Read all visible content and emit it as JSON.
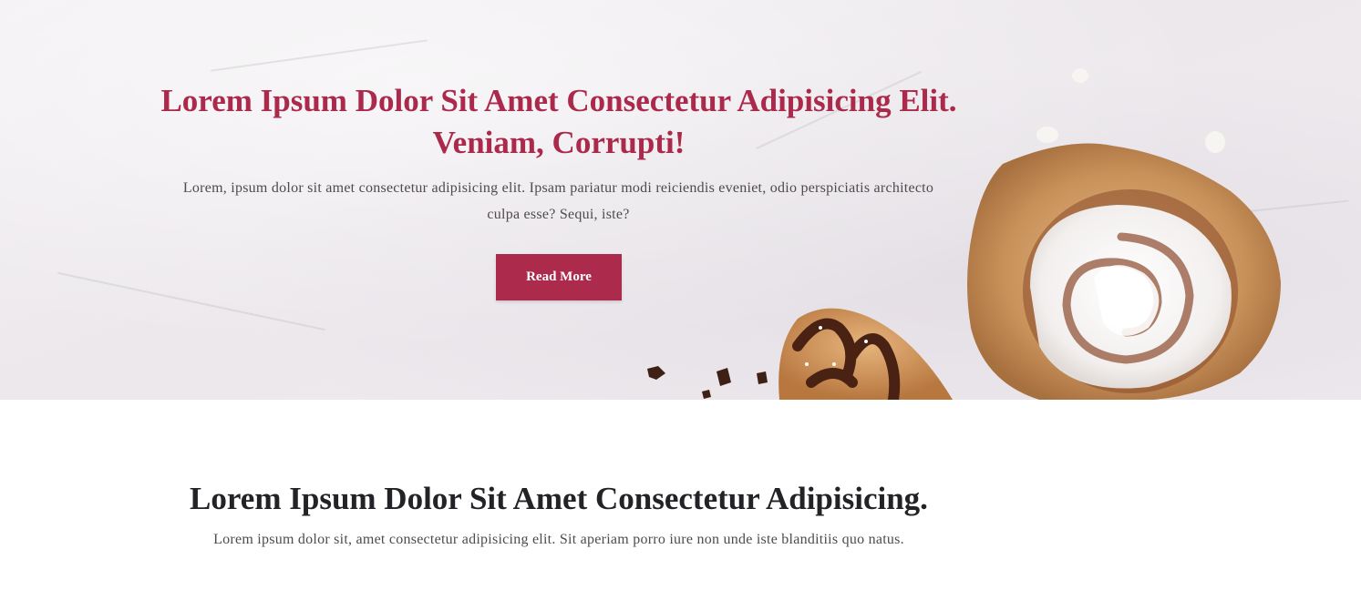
{
  "hero": {
    "title": "Lorem Ipsum Dolor Sit Amet Consectetur Adipisicing Elit. Veniam, Corrupti!",
    "text": "Lorem, ipsum dolor sit amet consectetur adipisicing elit. Ipsam pariatur modi reiciendis eveniet, odio perspiciatis architecto culpa esse? Sequi, iste?",
    "button_label": "Read More",
    "accent_color": "#ab2a4c",
    "image_icon": "pastry-image-icon"
  },
  "section": {
    "title": "Lorem Ipsum Dolor Sit Amet Consectetur Adipisicing.",
    "text": "Lorem ipsum dolor sit, amet consectetur adipisicing elit. Sit aperiam porro iure non unde iste blanditiis quo natus."
  }
}
